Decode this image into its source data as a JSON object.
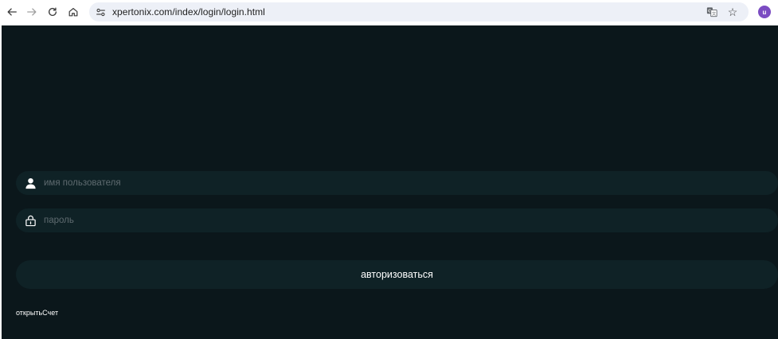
{
  "browser": {
    "url": "xpertonix.com/index/login/login.html",
    "avatar_letter": "u",
    "avatar_color": "#7b4cc2"
  },
  "page": {
    "background_color": "#0b171b",
    "field_color": "#0f2226"
  },
  "login_form": {
    "username_placeholder": "имя пользователя",
    "password_placeholder": "пароль",
    "submit_label": "авторизоваться",
    "open_account_label": "открытьСчет"
  }
}
